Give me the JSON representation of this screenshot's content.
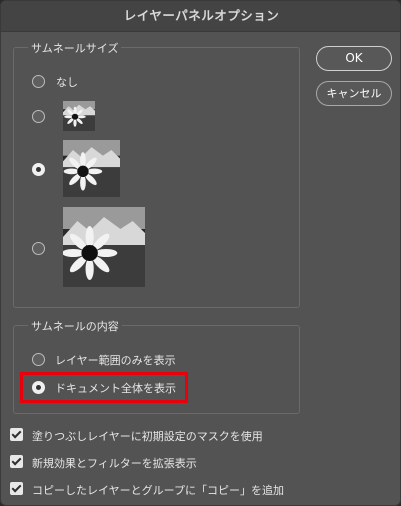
{
  "dialog": {
    "title": "レイヤーパネルオプション"
  },
  "thumbnail_size": {
    "group_title": "サムネールサイズ",
    "options": [
      {
        "label": "なし",
        "selected": false
      },
      {
        "label": "",
        "size": "small",
        "selected": false
      },
      {
        "label": "",
        "size": "medium",
        "selected": true
      },
      {
        "label": "",
        "size": "large",
        "selected": false
      }
    ]
  },
  "thumbnail_contents": {
    "group_title": "サムネールの内容",
    "options": [
      {
        "label": "レイヤー範囲のみを表示",
        "selected": false
      },
      {
        "label": "ドキュメント全体を表示",
        "selected": true
      }
    ]
  },
  "buttons": {
    "ok": "OK",
    "cancel": "キャンセル"
  },
  "checkboxes": [
    {
      "label": "塗りつぶしレイヤーに初期設定のマスクを使用",
      "checked": true
    },
    {
      "label": "新規効果とフィルターを拡張表示",
      "checked": true
    },
    {
      "label": "コピーしたレイヤーとグループに「コピー」を追加",
      "checked": true
    }
  ],
  "colors": {
    "highlight": "#e8000b",
    "dialog_bg": "#535353"
  },
  "icons": {
    "thumbnail": "sunflower-mountain-thumbnail"
  }
}
